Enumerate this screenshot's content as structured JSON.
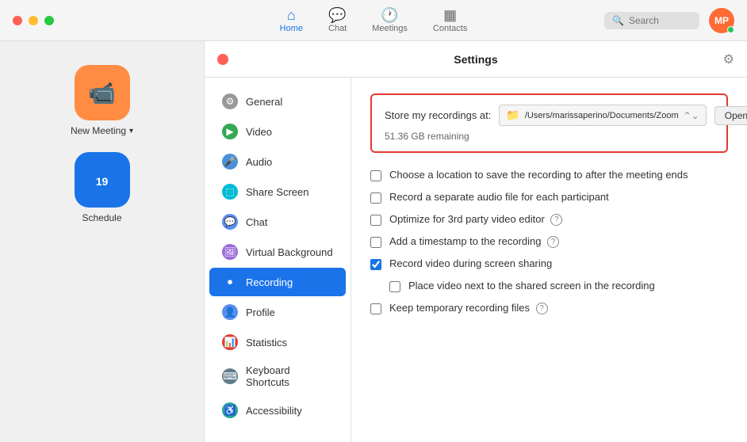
{
  "titlebar": {
    "traffic_lights": [
      "red",
      "yellow",
      "green"
    ],
    "nav_tabs": [
      {
        "id": "home",
        "label": "Home",
        "icon": "⌂",
        "active": true
      },
      {
        "id": "chat",
        "label": "Chat",
        "icon": "💬",
        "active": false
      },
      {
        "id": "meetings",
        "label": "Meetings",
        "icon": "🕐",
        "active": false
      },
      {
        "id": "contacts",
        "label": "Contacts",
        "icon": "▦",
        "active": false
      }
    ],
    "search_placeholder": "Search",
    "avatar_initials": "MP",
    "avatar_color": "#ff8c42"
  },
  "left_sidebar": {
    "buttons": [
      {
        "id": "new-meeting",
        "label": "New Meeting",
        "icon": "📹",
        "color": "#ff8c42",
        "has_dropdown": true
      },
      {
        "id": "schedule",
        "label": "Schedule",
        "icon": "📅",
        "color": "#1a73e8",
        "has_dropdown": false
      }
    ]
  },
  "settings": {
    "title": "Settings",
    "close_button_label": "close",
    "sidebar_items": [
      {
        "id": "general",
        "label": "General",
        "icon": "⚙",
        "icon_style": "gray"
      },
      {
        "id": "video",
        "label": "Video",
        "icon": "▶",
        "icon_style": "green"
      },
      {
        "id": "audio",
        "label": "Audio",
        "icon": "🎤",
        "icon_style": "blue-light"
      },
      {
        "id": "share-screen",
        "label": "Share Screen",
        "icon": "⬚",
        "icon_style": "teal"
      },
      {
        "id": "chat",
        "label": "Chat",
        "icon": "💬",
        "icon_style": "chat"
      },
      {
        "id": "virtual-background",
        "label": "Virtual Background",
        "icon": "🖼",
        "icon_style": "purple"
      },
      {
        "id": "recording",
        "label": "Recording",
        "icon": "⏺",
        "icon_style": "white",
        "active": true
      },
      {
        "id": "profile",
        "label": "Profile",
        "icon": "👤",
        "icon_style": "person"
      },
      {
        "id": "statistics",
        "label": "Statistics",
        "icon": "📊",
        "icon_style": "stats"
      },
      {
        "id": "keyboard-shortcuts",
        "label": "Keyboard Shortcuts",
        "icon": "⌨",
        "icon_style": "kbd"
      },
      {
        "id": "accessibility",
        "label": "Accessibility",
        "icon": "♿",
        "icon_style": "access"
      }
    ],
    "recording": {
      "storage_label": "Store my recordings at:",
      "storage_path": "/Users/marissaperino/Documents/Zoom",
      "storage_space": "51.36 GB remaining",
      "open_button": "Open",
      "checkboxes": [
        {
          "id": "choose-location",
          "label": "Choose a location to save the recording to after the meeting ends",
          "checked": false
        },
        {
          "id": "separate-audio",
          "label": "Record a separate audio file for each participant",
          "checked": false
        },
        {
          "id": "optimize-3rdparty",
          "label": "Optimize for 3rd party video editor",
          "checked": false,
          "has_help": true
        },
        {
          "id": "timestamp",
          "label": "Add a timestamp to the recording",
          "checked": false,
          "has_help": true
        },
        {
          "id": "record-video-sharing",
          "label": "Record video during screen sharing",
          "checked": true
        },
        {
          "id": "place-video",
          "label": "Place video next to the shared screen in the recording",
          "checked": false,
          "sub": true
        },
        {
          "id": "keep-temp",
          "label": "Keep temporary recording files",
          "checked": false,
          "has_help": true
        }
      ]
    }
  }
}
